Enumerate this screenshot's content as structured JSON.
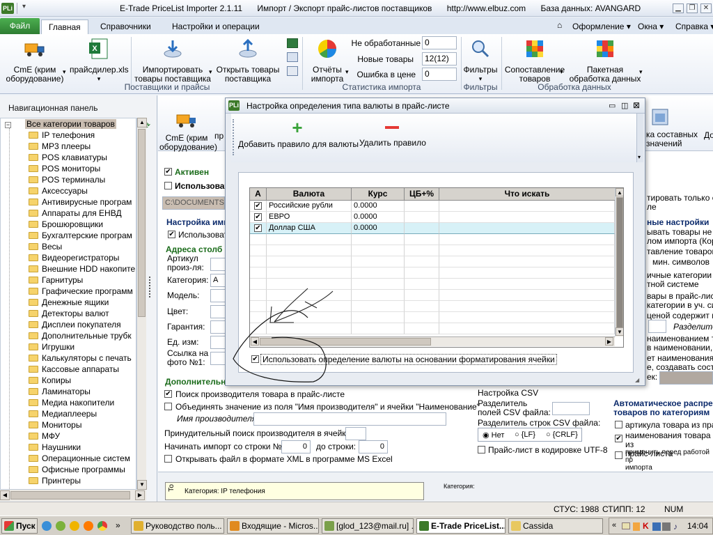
{
  "window": {
    "app_badge": "PLi",
    "title_app": "E-Trade PriceList Importer 2.1.11",
    "title_desc": "Импорт / Экспорт прайс-листов поставщиков",
    "title_url": "http://www.elbuz.com",
    "title_db": "База данных: AVANGARD"
  },
  "tabs": {
    "file": "Файл",
    "home": "Главная",
    "refs": "Справочники",
    "settings": "Настройки и операции",
    "design": "Оформление",
    "windows": "Окна",
    "help": "Справка"
  },
  "ribbon": {
    "btn_cme": "CmE (крим\nоборудование)",
    "btn_pricedealer": "прайсдилер.xls",
    "btn_import_goods": "Импортировать\nтовары поставщика",
    "btn_open_goods": "Открыть товары\nпоставщика",
    "group_suppliers": "Поставщики и прайсы",
    "btn_reports": "Отчёты\nимпорта",
    "stat_unprocessed_label": "Не обработанные",
    "stat_unprocessed_val": "0",
    "stat_new_label": "Новые товары",
    "stat_new_val": "12(12)",
    "stat_error_label": "Ошибка в цене",
    "stat_error_val": "0",
    "group_stats": "Статистика импорта",
    "btn_filters": "Фильтры",
    "group_filters": "Фильтры",
    "btn_match": "Сопоставление\nтоваров",
    "btn_batch": "Пакетная\nобработка данных",
    "group_processing": "Обработка данных"
  },
  "nav": {
    "header": "Навигационная панель",
    "root": "Все категории товаров",
    "items": [
      "IP телефония",
      "MP3 плееры",
      "POS клавиатуры",
      "POS мониторы",
      "POS терминалы",
      "Аксессуары",
      "Антивирусные програм",
      "Аппараты для ЕНВД",
      "Брошюровщики",
      "Бухгалтерские програм",
      "Весы",
      "Видеорегистраторы",
      "Внешние HDD накопите",
      "Гарнитуры",
      "Графические программ",
      "Денежные ящики",
      "Детекторы валют",
      "Дисплеи покупателя",
      "Дополнительные трубк",
      "Игрушки",
      "Калькуляторы с печать",
      "Кассовые аппараты",
      "Копиры",
      "Ламинаторы",
      "Медиа накопители",
      "Медиаплееры",
      "Мониторы",
      "МФУ",
      "Наушники",
      "Операционные систем",
      "Офисные программы",
      "Принтеры"
    ]
  },
  "bg": {
    "tb_cme": "CmE (крим\nоборудование)",
    "tb_pr": "пр",
    "tb_right1": "ка составных\nзначений",
    "tb_right2": "До",
    "active": "Активен",
    "use1": "Использоват",
    "path": "C:\\DOCUMENTS A",
    "import_settings": "Настройка имп",
    "use2": "Использоват",
    "col_addresses": "Адреса столб",
    "article": "Артикул\nпроиз-ля:",
    "category": "Категория:",
    "category_val": "A",
    "model": "Модель:",
    "color": "Цвет:",
    "warranty": "Гарантия:",
    "unit": "Ед. изм:",
    "photo": "Ссылка на\nфото №1:",
    "additional": "Дополнительн",
    "search_maker": "Поиск производителя товара в прайс-листе",
    "merge_maker": "Объединять значение из поля \"Имя производителя\" и ячейки \"Наименование\"",
    "maker_name": "Имя производителя:",
    "forced_search": "Принудительный поиск производителя в ячейке:",
    "start_row": "Начинать импорт со строки №:",
    "start_row_val": "0",
    "to_row": "до строки:",
    "to_row_val": "0",
    "open_xml": "Открывать файл в формате XML в программе MS Excel",
    "csv_title": "Настройка CSV",
    "csv_field_sep": "Разделитель\nполей CSV файла:",
    "csv_row_sep": "Разделитель строк CSV файла:",
    "csv_opt_none": "Нет",
    "csv_opt_lf": "{LF}",
    "csv_opt_crlf": "{CRLF}",
    "csv_utf8": "Прайс-лист в кодировке UTF-8",
    "right_1": "тировать только е",
    "right_2": "ле",
    "right_hdg": "ные настройки",
    "right_3": "ывать товары не о",
    "right_4": "лом импорта (Корз",
    "right_5": "тавление товаров",
    "right_6": "мин. символов",
    "right_7": "ичные категории в",
    "right_8": "тной системе",
    "right_9": "вары в прайс-лист",
    "right_10": "категории в уч. си",
    "right_11": "ценой содержит не",
    "right_12": "Разделите",
    "right_13": "наименованием то",
    "right_14": "в наименовании, д",
    "right_15": "ет наименования т",
    "right_16": "е, создавать соста",
    "right_17": "ек:",
    "auto_hdg": "Автоматическое распре\nтоваров по категориям",
    "auto_1": "артикула товара из прай",
    "auto_2": "наименования товара из\nпрайс-листа",
    "auto_3": "применить перед работой пр\nимпорта",
    "tooltip_label": "То",
    "tooltip_text": "Категория: IP телефония",
    "tooltip_text2": "Категория:"
  },
  "dialog": {
    "badge": "PLi",
    "title": "Настройка определения типа валюты в прайс-листе",
    "add_rule": "Добавить правило для валюты",
    "delete_rule": "Удалить правило",
    "col_a": "A",
    "col_currency": "Валюта",
    "col_rate": "Курс",
    "col_cb": "ЦБ+%",
    "col_search": "Что искать",
    "rows": [
      {
        "currency": "Российские рубли",
        "rate": "0.0000"
      },
      {
        "currency": "ЕВРО",
        "rate": "0.0000"
      },
      {
        "currency": "Доллар США",
        "rate": "0.0000"
      }
    ],
    "use_format": "Использовать определение валюты на основании форматирования ячейки"
  },
  "status": {
    "stus": "СТУС: 1988",
    "stipp": "СТИПП: 12",
    "num": "NUM"
  },
  "taskbar": {
    "start": "Пуск",
    "items": [
      "Руководство поль...",
      "Входящие - Micros...",
      "[glod_123@mail.ru] ...",
      "E-Trade PriceList...",
      "Cassida"
    ],
    "lang": "EN",
    "time": "14:04"
  },
  "colors": {
    "accent": "#2e7d32",
    "ribbon": "#e9eef6",
    "selection": "#c9bdb1"
  }
}
